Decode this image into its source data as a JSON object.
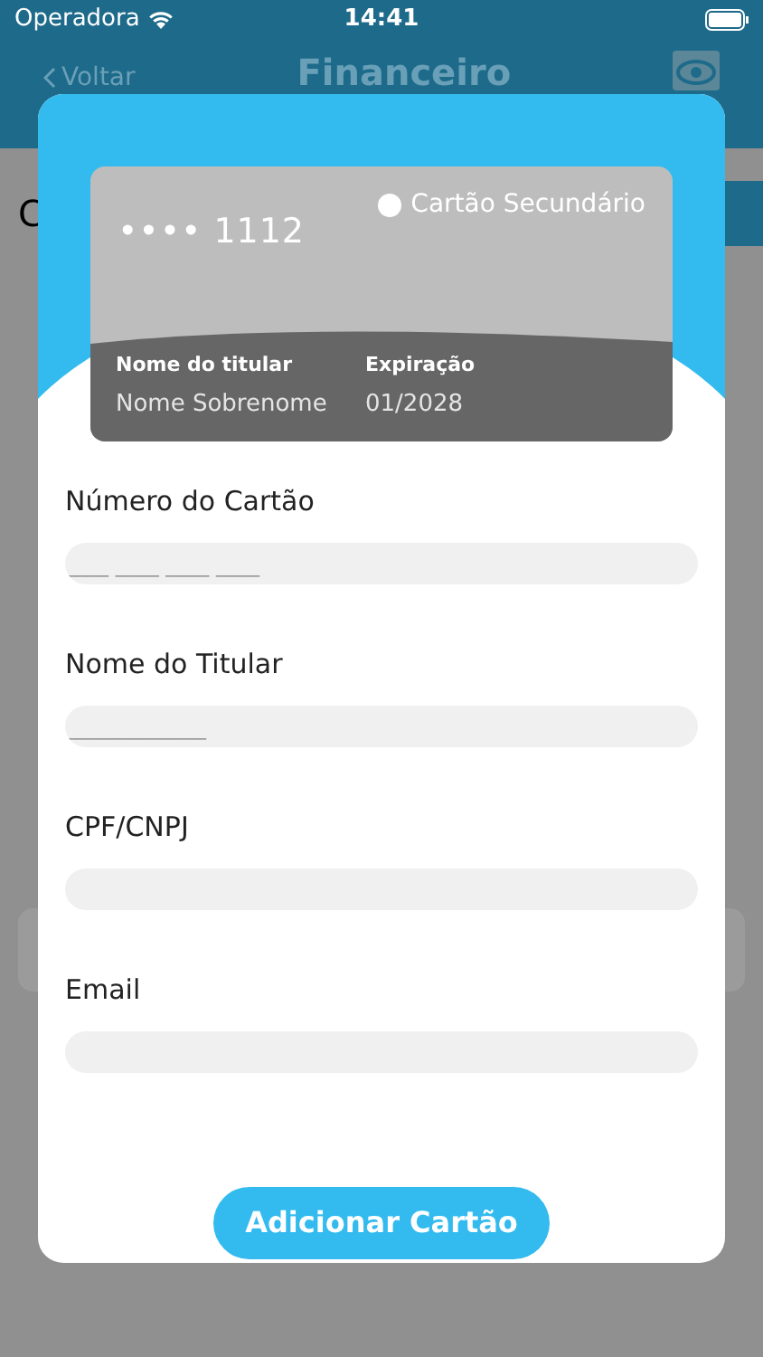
{
  "status_bar": {
    "carrier": "Operadora",
    "time": "14:41"
  },
  "nav": {
    "back": "Voltar",
    "title": "Financeiro"
  },
  "background": {
    "row_label": "C"
  },
  "modal": {
    "card": {
      "number": "•••• 1112",
      "badge": "Cartão Secundário",
      "holder_label": "Nome do titular",
      "holder": "Nome Sobrenome",
      "expiry_label": "Expiração",
      "expiry": "01/2028"
    },
    "fields": [
      {
        "label": "Número do Cartão",
        "placeholder": "____ ____ ____ ____"
      },
      {
        "label": "Nome do Titular",
        "placeholder": "_____________"
      },
      {
        "label": "CPF/CNPJ"
      },
      {
        "label": "Email"
      }
    ],
    "button": "Adicionar Cartão"
  }
}
